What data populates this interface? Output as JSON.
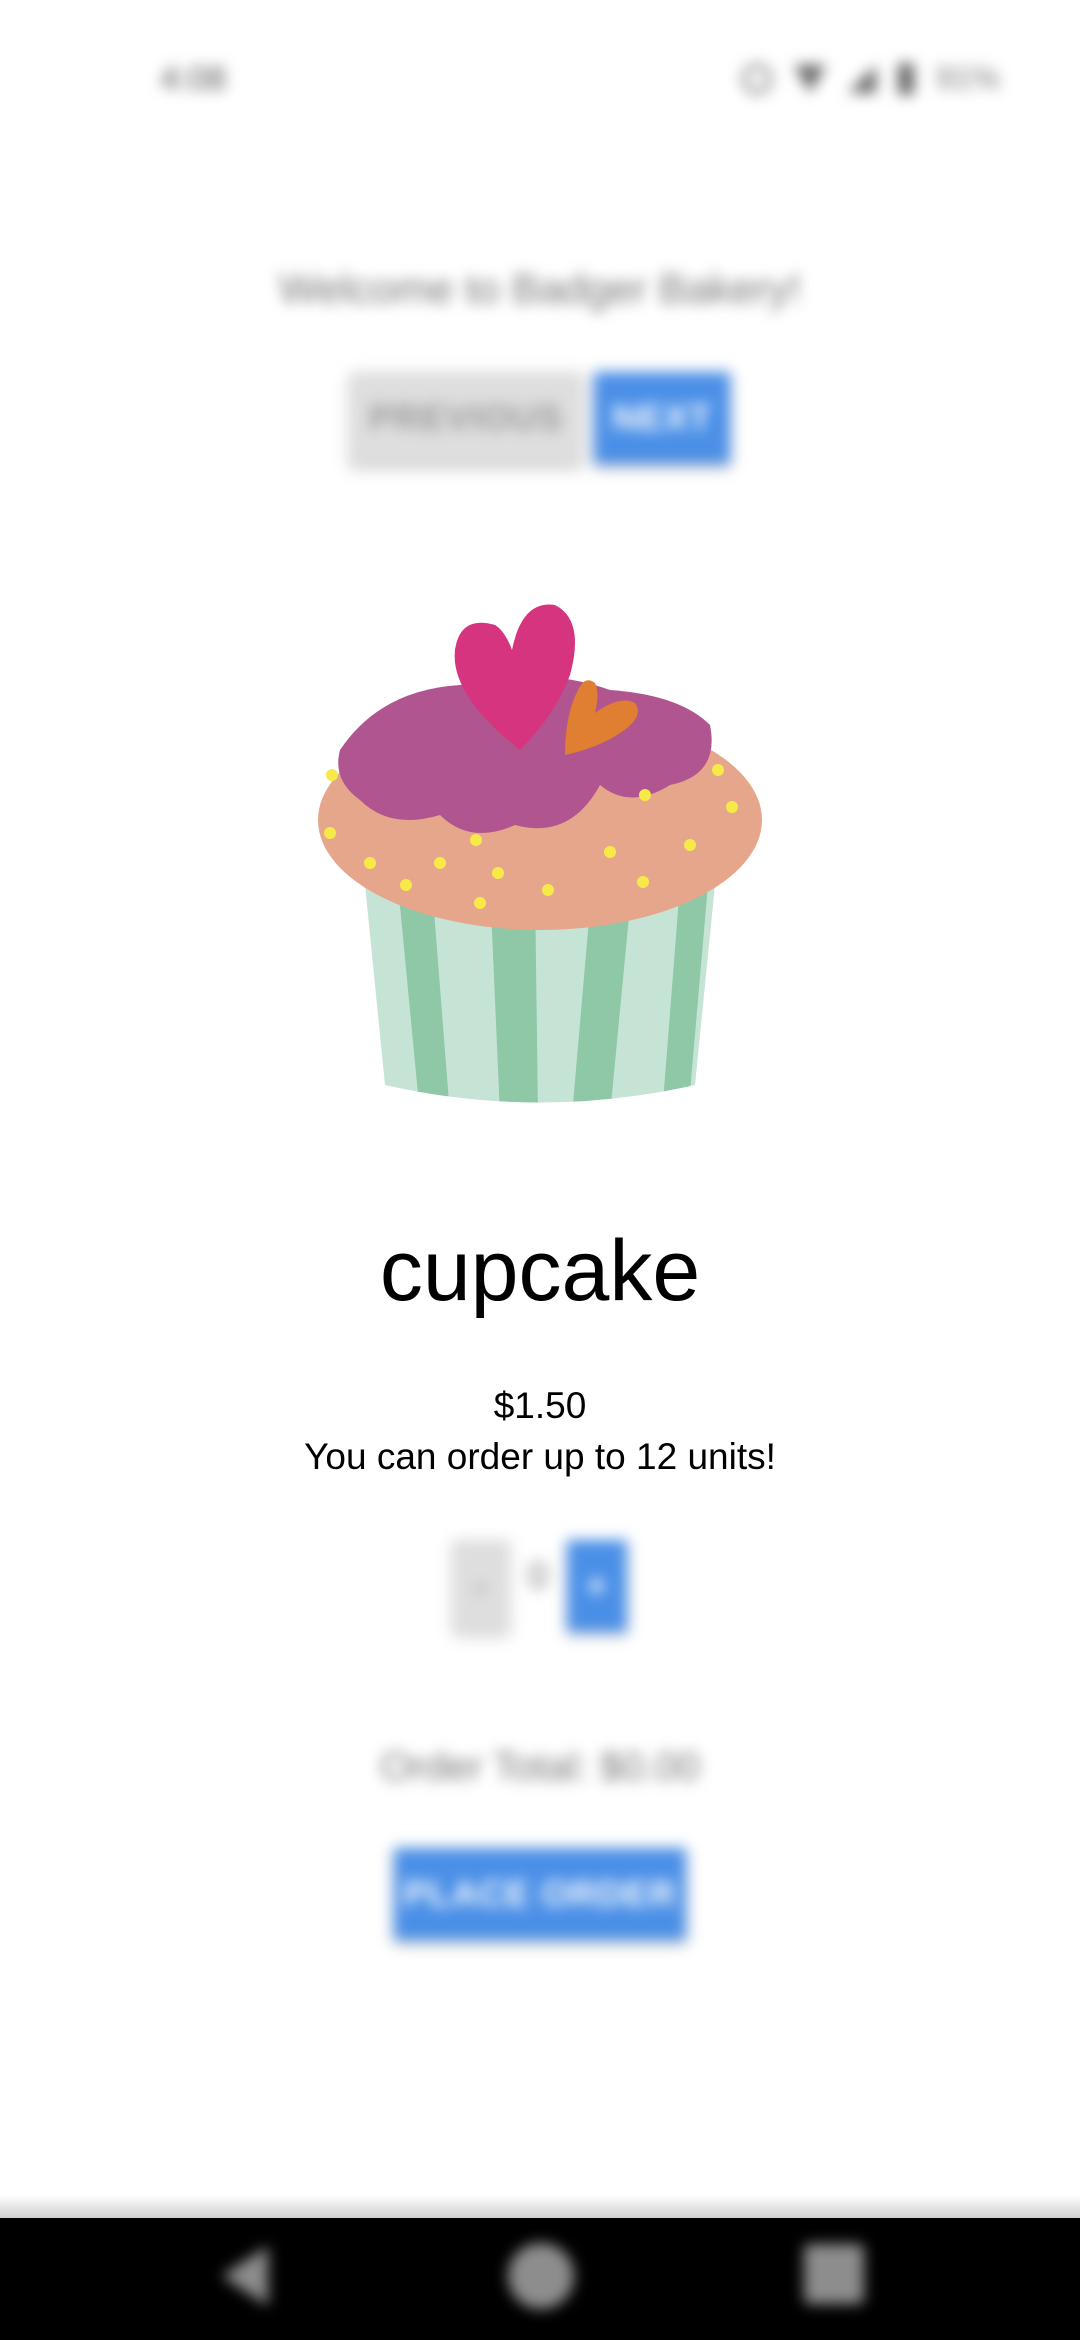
{
  "status_bar": {
    "time": "4:08",
    "battery": "91%"
  },
  "header": {
    "welcome_text": "Welcome to Badger Bakery!",
    "previous_label": "PREVIOUS",
    "next_label": "NEXT"
  },
  "product": {
    "image_icon": "cupcake-image",
    "name": "cupcake",
    "price": "$1.50",
    "limit_text": "You can order up to 12 units!"
  },
  "quantity": {
    "minus_label": "-",
    "value": "0",
    "plus_label": "+"
  },
  "order": {
    "total_text": "Order Total: $0.00",
    "place_order_label": "PLACE ORDER"
  },
  "nav_bar": {
    "back_icon": "back-triangle-icon",
    "home_icon": "home-circle-icon",
    "recents_icon": "recents-square-icon"
  },
  "colors": {
    "accent": "#4a8fe7",
    "disabled": "#dedede"
  }
}
